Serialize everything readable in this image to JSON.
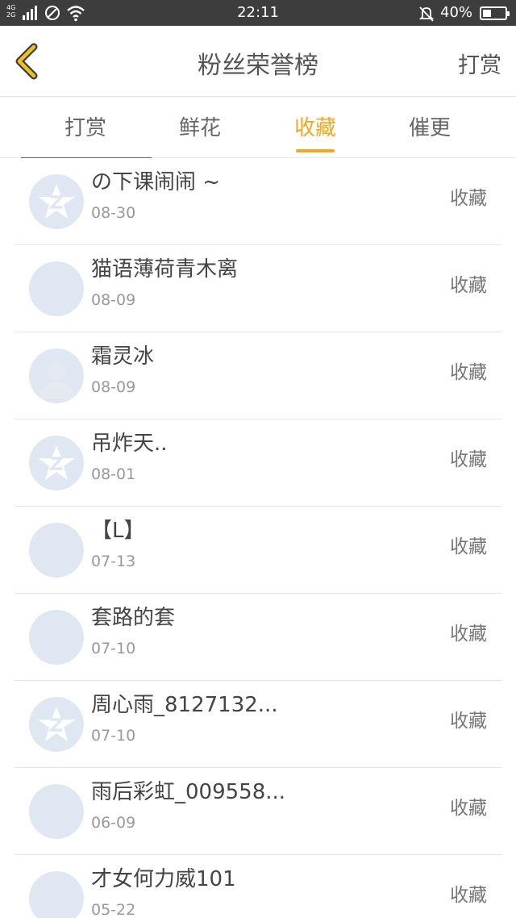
{
  "status_bar": {
    "network": "4G 2G",
    "time": "22:11",
    "battery_pct": "40%",
    "battery_level": 0.4
  },
  "header": {
    "title": "粉丝荣誉榜",
    "action": "打赏"
  },
  "tabs": [
    {
      "label": "打赏",
      "active": false
    },
    {
      "label": "鲜花",
      "active": false
    },
    {
      "label": "收藏",
      "active": true
    },
    {
      "label": "催更",
      "active": false
    }
  ],
  "accent_color": "#f5a623",
  "fans": [
    {
      "name": "の下课闹闹 ~",
      "date": "08-30",
      "type": "收藏",
      "avatar": "default-star"
    },
    {
      "name": "猫语薄荷青木离",
      "date": "08-09",
      "type": "收藏",
      "avatar": "photo"
    },
    {
      "name": "霜灵冰",
      "date": "08-09",
      "type": "收藏",
      "avatar": "default-person"
    },
    {
      "name": "吊炸天..",
      "date": "08-01",
      "type": "收藏",
      "avatar": "default-star"
    },
    {
      "name": "【L】",
      "date": "07-13",
      "type": "收藏",
      "avatar": "photo"
    },
    {
      "name": "套路的套",
      "date": "07-10",
      "type": "收藏",
      "avatar": "photo"
    },
    {
      "name": "周心雨_8127132...",
      "date": "07-10",
      "type": "收藏",
      "avatar": "default-star"
    },
    {
      "name": "雨后彩虹_009558...",
      "date": "06-09",
      "type": "收藏",
      "avatar": "photo"
    },
    {
      "name": "才女何力威101",
      "date": "05-22",
      "type": "收藏",
      "avatar": "photo"
    }
  ]
}
